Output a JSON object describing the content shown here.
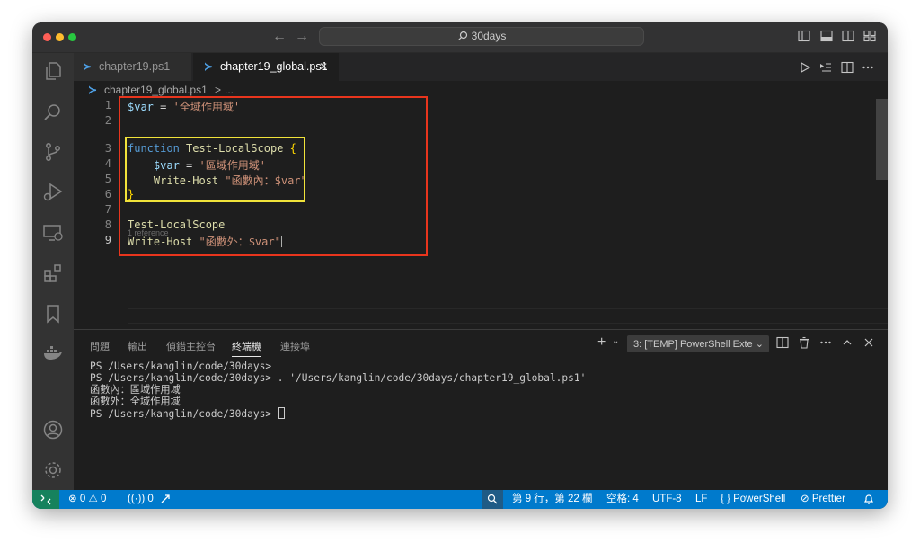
{
  "window": {
    "command_center": "30days"
  },
  "tabs": [
    {
      "label": "chapter19.ps1",
      "icon": "powershell-icon"
    },
    {
      "label": "chapter19_global.ps1",
      "icon": "powershell-icon",
      "close": "✕"
    }
  ],
  "breadcrumb": {
    "file": "chapter19_global.ps1",
    "sep": ">",
    "more": "..."
  },
  "editor": {
    "line_numbers": [
      "1",
      "2",
      "3",
      "4",
      "5",
      "6",
      "7",
      "8",
      "9"
    ],
    "codelens": "1 reference",
    "lines": {
      "l1": {
        "var": "$var",
        "op": " = ",
        "str": "'全域作用域'"
      },
      "l3": {
        "kw": "function",
        "name": " Test-LocalScope ",
        "brace": "{"
      },
      "l4": {
        "indent": "    ",
        "var": "$var",
        "op": " = ",
        "str": "'區域作用域'"
      },
      "l5": {
        "indent": "    ",
        "cmd": "Write-Host ",
        "str": "\"函數內：$var\""
      },
      "l6": {
        "brace": "}"
      },
      "l8": {
        "cmd": "Test-LocalScope"
      },
      "l9": {
        "cmd": "Write-Host ",
        "str": "\"函數外：$var\""
      }
    }
  },
  "panel": {
    "tabs": [
      "問題",
      "輸出",
      "偵錯主控台",
      "終端機",
      "連接埠"
    ],
    "active_tab": "終端機",
    "terminal_select": "3: [TEMP] PowerShell Exte",
    "terminal_lines": [
      "PS /Users/kanglin/code/30days>",
      "PS /Users/kanglin/code/30days> . '/Users/kanglin/code/30days/chapter19_global.ps1'",
      "函數內：區域作用域",
      "函數外：全域作用域",
      "PS /Users/kanglin/code/30days> "
    ]
  },
  "statusbar": {
    "errors": "0",
    "warnings": "0",
    "ports": "0",
    "position": "第 9 行，第 22 欄",
    "spaces": "空格: 4",
    "encoding": "UTF-8",
    "eol": "LF",
    "language": "PowerShell",
    "formatter": "Prettier"
  },
  "colors": {
    "statusbar": "#007acc",
    "annotation_red": "#e8351d",
    "annotation_yellow": "#f1e33a"
  }
}
